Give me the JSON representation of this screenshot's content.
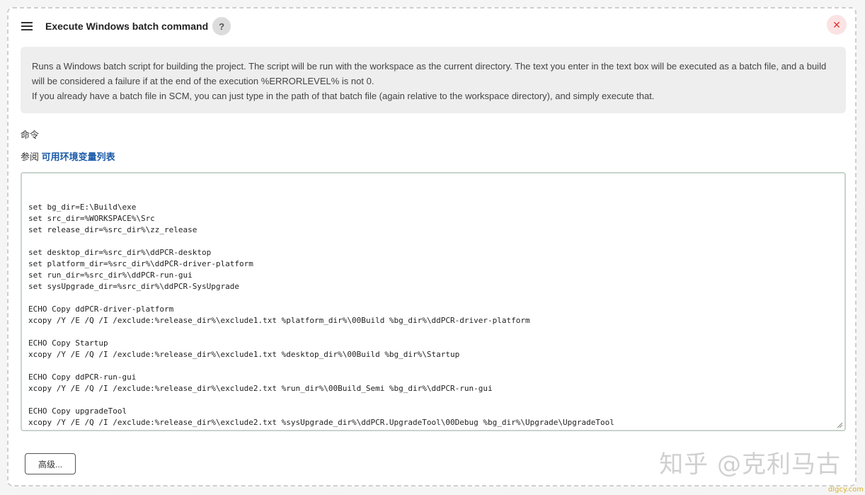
{
  "step": {
    "title": "Execute Windows batch command",
    "help_label": "?",
    "close_label": "✕",
    "description_lines": [
      "Runs a Windows batch script for building the project. The script will be run with the workspace as the current directory. The text you enter in the text box will be executed as a batch file, and a build will be considered a failure if at the end of the execution %ERRORLEVEL% is not 0.",
      "If you already have a batch file in SCM, you can just type in the path of that batch file (again relative to the workspace directory), and simply execute that."
    ],
    "command_label": "命令",
    "see_also_prefix": "参阅",
    "see_also_link": "可用环境变量列表",
    "command_lines": [
      "set bg_dir=E:\\Build\\exe",
      "set src_dir=%WORKSPACE%\\Src",
      "set release_dir=%src_dir%\\zz_release",
      "",
      "set desktop_dir=%src_dir%\\ddPCR-desktop",
      "set platform_dir=%src_dir%\\ddPCR-driver-platform",
      "set run_dir=%src_dir%\\ddPCR-run-gui",
      "set sysUpgrade_dir=%src_dir%\\ddPCR-SysUpgrade",
      "",
      "ECHO Copy ddPCR-driver-platform",
      "xcopy /Y /E /Q /I /exclude:%release_dir%\\exclude1.txt %platform_dir%\\00Build %bg_dir%\\ddPCR-driver-platform",
      "",
      "ECHO Copy Startup",
      "xcopy /Y /E /Q /I /exclude:%release_dir%\\exclude1.txt %desktop_dir%\\00Build %bg_dir%\\Startup",
      "",
      "ECHO Copy ddPCR-run-gui",
      "xcopy /Y /E /Q /I /exclude:%release_dir%\\exclude2.txt %run_dir%\\00Build_Semi %bg_dir%\\ddPCR-run-gui",
      "",
      "ECHO Copy upgradeTool",
      "xcopy /Y /E /Q /I /exclude:%release_dir%\\exclude2.txt %sysUpgrade_dir%\\ddPCR.UpgradeTool\\00Debug %bg_dir%\\Upgrade\\UpgradeTool"
    ],
    "advanced_button": "高级..."
  },
  "watermark": "知乎 @克利马古",
  "watermark_site": "dlgcy.com",
  "colors": {
    "link": "#1a5aa8",
    "close_bg": "#fbe3e3",
    "close_fg": "#d33333"
  }
}
